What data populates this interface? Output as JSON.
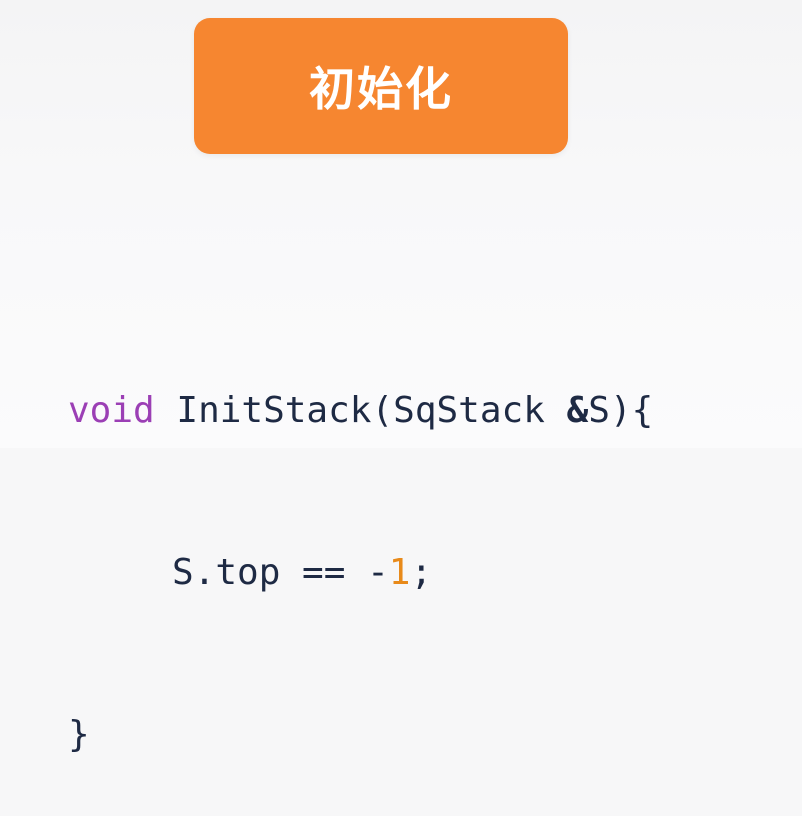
{
  "header_button": {
    "label": "初始化",
    "color": "#f68630"
  },
  "code": {
    "line1": {
      "keyword": "void",
      "space1": " ",
      "function_name": "InitStack",
      "open_paren": "(",
      "param_type": "SqStack",
      "space2": " ",
      "ampersand": "&",
      "param_name": "S",
      "close_paren": ")",
      "open_brace": "{"
    },
    "line2": {
      "lhs": "S.top",
      "operator": " == ",
      "minus": "-",
      "number": "1",
      "semicolon": ";"
    },
    "line3": {
      "close_brace": "}"
    },
    "colors": {
      "keyword": "#9b3fb5",
      "text": "#1e2a44",
      "number": "#e88a1a"
    }
  }
}
